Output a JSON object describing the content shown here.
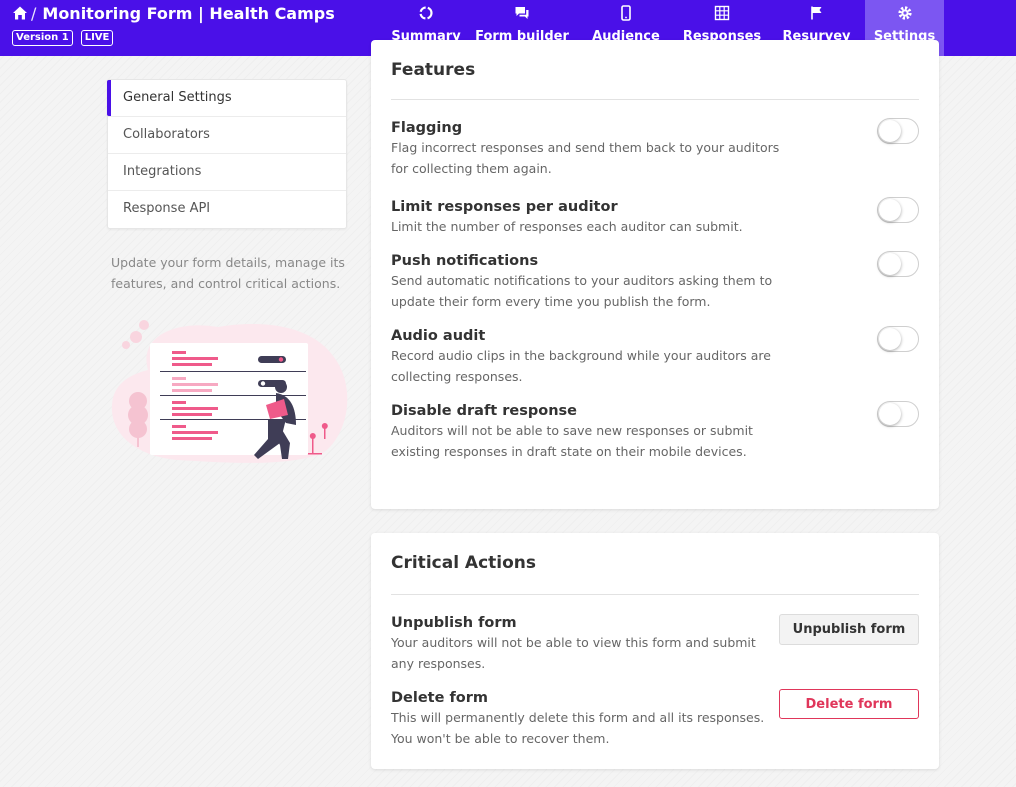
{
  "header": {
    "title": "Monitoring Form | Health Camps",
    "separator": "/",
    "version_badge": "Version 1",
    "status_badge": "LIVE",
    "colors": {
      "bar": "#4a10e8",
      "active_tab": "#7c56f2"
    }
  },
  "tabs": [
    {
      "label": "Summary",
      "icon": "summary-icon"
    },
    {
      "label": "Form builder",
      "icon": "chat-icon"
    },
    {
      "label": "Audience",
      "icon": "mobile-icon"
    },
    {
      "label": "Responses",
      "icon": "grid-icon"
    },
    {
      "label": "Resurvey",
      "icon": "flag-icon"
    },
    {
      "label": "Settings",
      "icon": "gear-icon",
      "active": true
    }
  ],
  "sidebar": {
    "items": [
      {
        "label": "General Settings",
        "active": true
      },
      {
        "label": "Collaborators"
      },
      {
        "label": "Integrations"
      },
      {
        "label": "Response API"
      }
    ],
    "description": "Update your form details, manage its features, and control critical actions."
  },
  "features": {
    "heading": "Features",
    "items": [
      {
        "title": "Flagging",
        "description": "Flag incorrect responses and send them back to your auditors for collecting them again.",
        "enabled": false
      },
      {
        "title": "Limit responses per auditor",
        "description": "Limit the number of responses each auditor can submit.",
        "enabled": false
      },
      {
        "title": "Push notifications",
        "description": "Send automatic notifications to your auditors asking them to update their form every time you publish the form.",
        "enabled": false
      },
      {
        "title": "Audio audit",
        "description": "Record audio clips in the background while your auditors are collecting responses.",
        "enabled": false
      },
      {
        "title": "Disable draft response",
        "description": "Auditors will not be able to save new responses or submit existing responses in draft state on their mobile devices.",
        "enabled": false
      }
    ]
  },
  "critical": {
    "heading": "Critical Actions",
    "unpublish": {
      "title": "Unpublish form",
      "description": "Your auditors will not be able to view this form and submit any responses.",
      "button": "Unpublish form"
    },
    "delete": {
      "title": "Delete form",
      "description": "This will permanently delete this form and all its responses. You won't be able to recover them.",
      "button": "Delete form",
      "color": "#e0365a"
    }
  }
}
